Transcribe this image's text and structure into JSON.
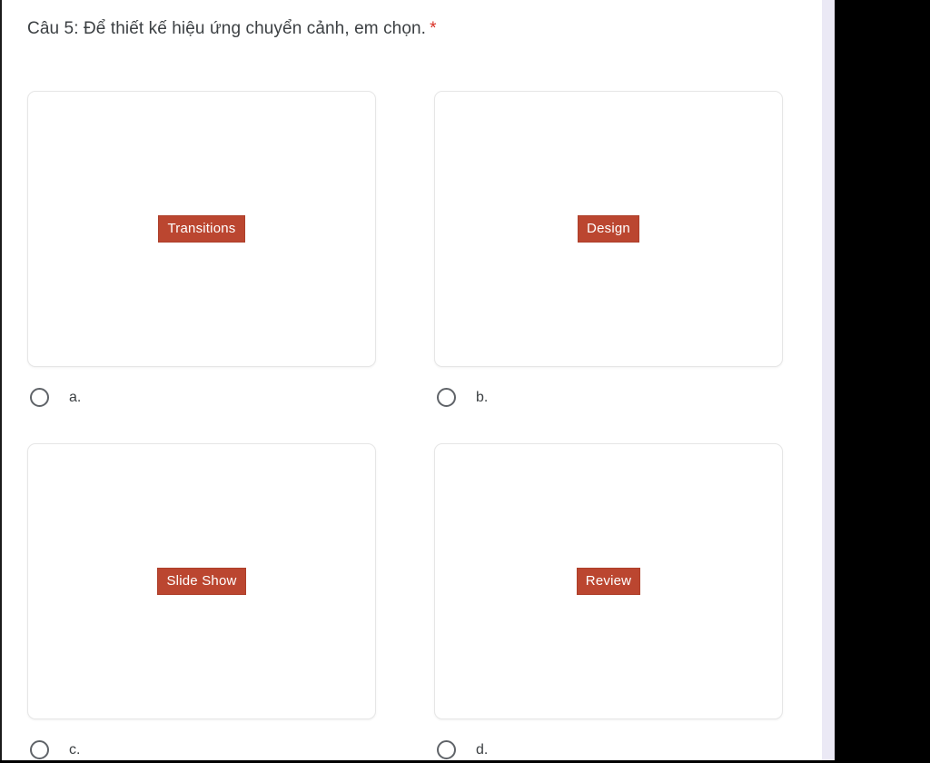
{
  "question": {
    "text": "Câu 5: Để thiết kế hiệu ứng chuyển cảnh, em chọn.",
    "required_marker": "*",
    "required_color": "#d93025"
  },
  "theme": {
    "page_background": "#ffffff",
    "gutter_color": "#ebe9f5",
    "letterbox_color": "#000000",
    "card_border": "#e6e6e6",
    "badge_background": "#bb4630",
    "badge_text_color": "#ffffff",
    "text_color": "#3c4043",
    "radio_border": "#5f6368"
  },
  "options": [
    {
      "id": "a",
      "label": "a.",
      "image_badge": "Transitions",
      "selected": false,
      "radio_icon": "radio-unchecked-icon"
    },
    {
      "id": "b",
      "label": "b.",
      "image_badge": "Design",
      "selected": false,
      "radio_icon": "radio-unchecked-icon"
    },
    {
      "id": "c",
      "label": "c.",
      "image_badge": "Slide Show",
      "selected": false,
      "radio_icon": "radio-unchecked-icon"
    },
    {
      "id": "d",
      "label": "d.",
      "image_badge": "Review",
      "selected": false,
      "radio_icon": "radio-unchecked-icon"
    }
  ]
}
